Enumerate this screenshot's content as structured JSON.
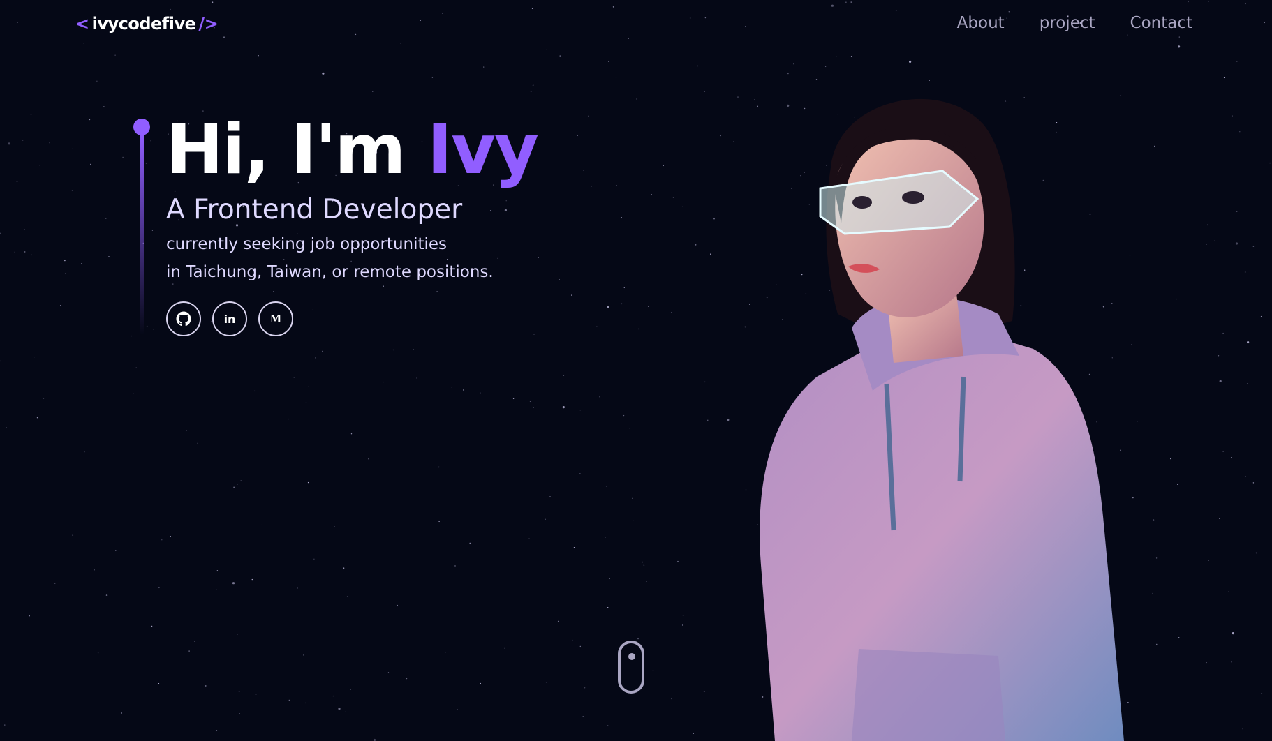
{
  "nav": {
    "logo_open": "<",
    "logo_name": "ivycodefive",
    "logo_close": "/>",
    "links": [
      "About",
      "project",
      "Contact"
    ]
  },
  "hero": {
    "greeting": "Hi, I'm",
    "name": "Ivy",
    "role": "A Frontend Developer",
    "line1": "currently seeking job opportunities",
    "line2": "in Taichung, Taiwan, or remote positions."
  },
  "socials": [
    {
      "icon": "github-icon"
    },
    {
      "icon": "linkedin-icon",
      "label": "in"
    },
    {
      "icon": "medium-icon",
      "label": "M"
    }
  ],
  "colors": {
    "background": "#050816",
    "accent": "#915EFF",
    "nav_text": "#aaa6c3",
    "body_text": "#dfd9ff"
  }
}
